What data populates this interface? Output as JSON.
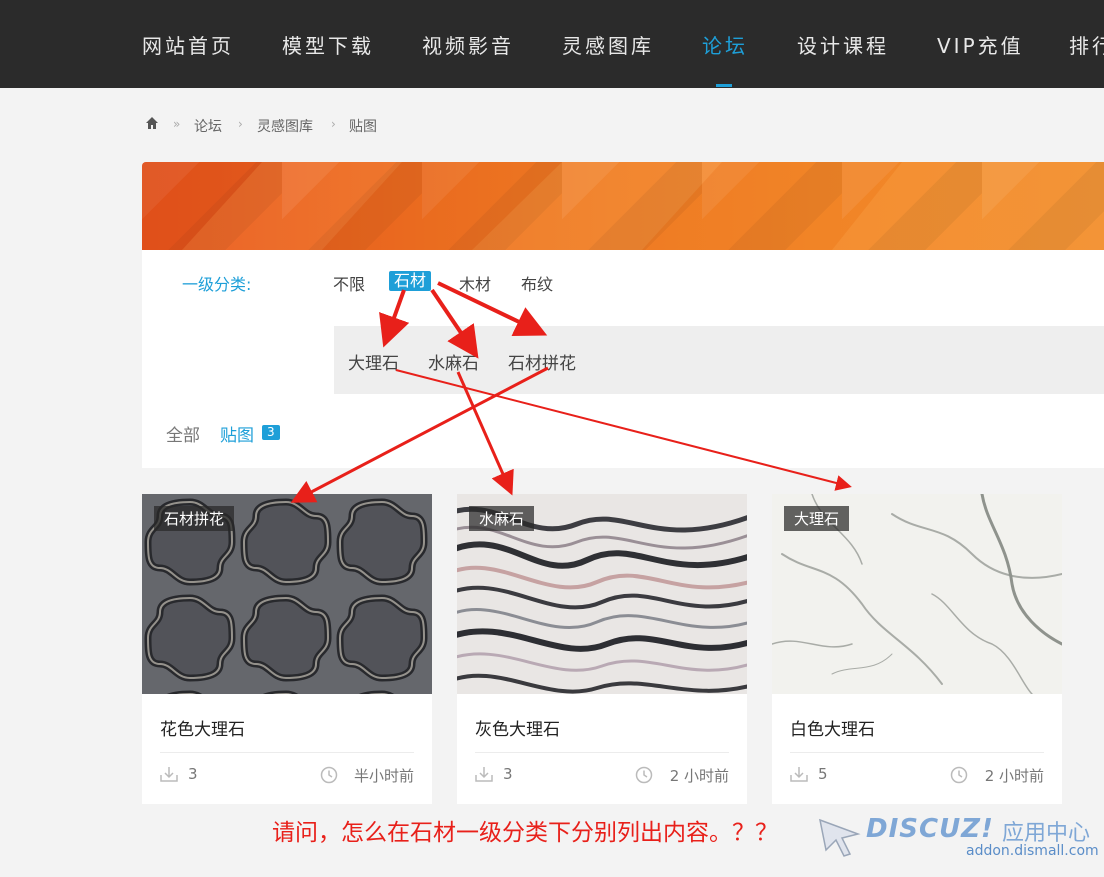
{
  "topnav": {
    "items": [
      {
        "label": "网站首页"
      },
      {
        "label": "模型下载"
      },
      {
        "label": "视频影音"
      },
      {
        "label": "灵感图库"
      },
      {
        "label": "论坛",
        "active": true
      },
      {
        "label": "设计课程"
      },
      {
        "label": "VIP充值"
      },
      {
        "label": "排行"
      }
    ]
  },
  "breadcrumb": {
    "home_icon": "home-icon",
    "items": [
      "论坛",
      "灵感图库",
      "贴图"
    ],
    "separator": "»",
    "separator2": "›"
  },
  "filter": {
    "label": "一级分类:",
    "options": [
      "不限",
      "石材",
      "木材",
      "布纹"
    ],
    "selected": "石材",
    "sub_options": [
      "大理石",
      "水麻石",
      "石材拼花"
    ]
  },
  "tabs": {
    "all": "全部",
    "current": "贴图",
    "count": "3"
  },
  "cards": [
    {
      "tag": "石材拼花",
      "title": "花色大理石",
      "downloads": "3",
      "time": "半小时前"
    },
    {
      "tag": "水麻石",
      "title": "灰色大理石",
      "downloads": "3",
      "time": "2 小时前"
    },
    {
      "tag": "大理石",
      "title": "白色大理石",
      "downloads": "5",
      "time": "2 小时前"
    }
  ],
  "annotation": {
    "question": "请问，怎么在石材一级分类下分别列出内容。？？"
  },
  "watermark": {
    "logo": "DISCUZ!",
    "logo_suffix": "应用中心",
    "url": "addon.dismall.com"
  },
  "colors": {
    "accent": "#1e9fd8",
    "nav_bg": "#2b2b2b",
    "banner": "#ef7a24",
    "annotation_red": "#e8201a"
  }
}
